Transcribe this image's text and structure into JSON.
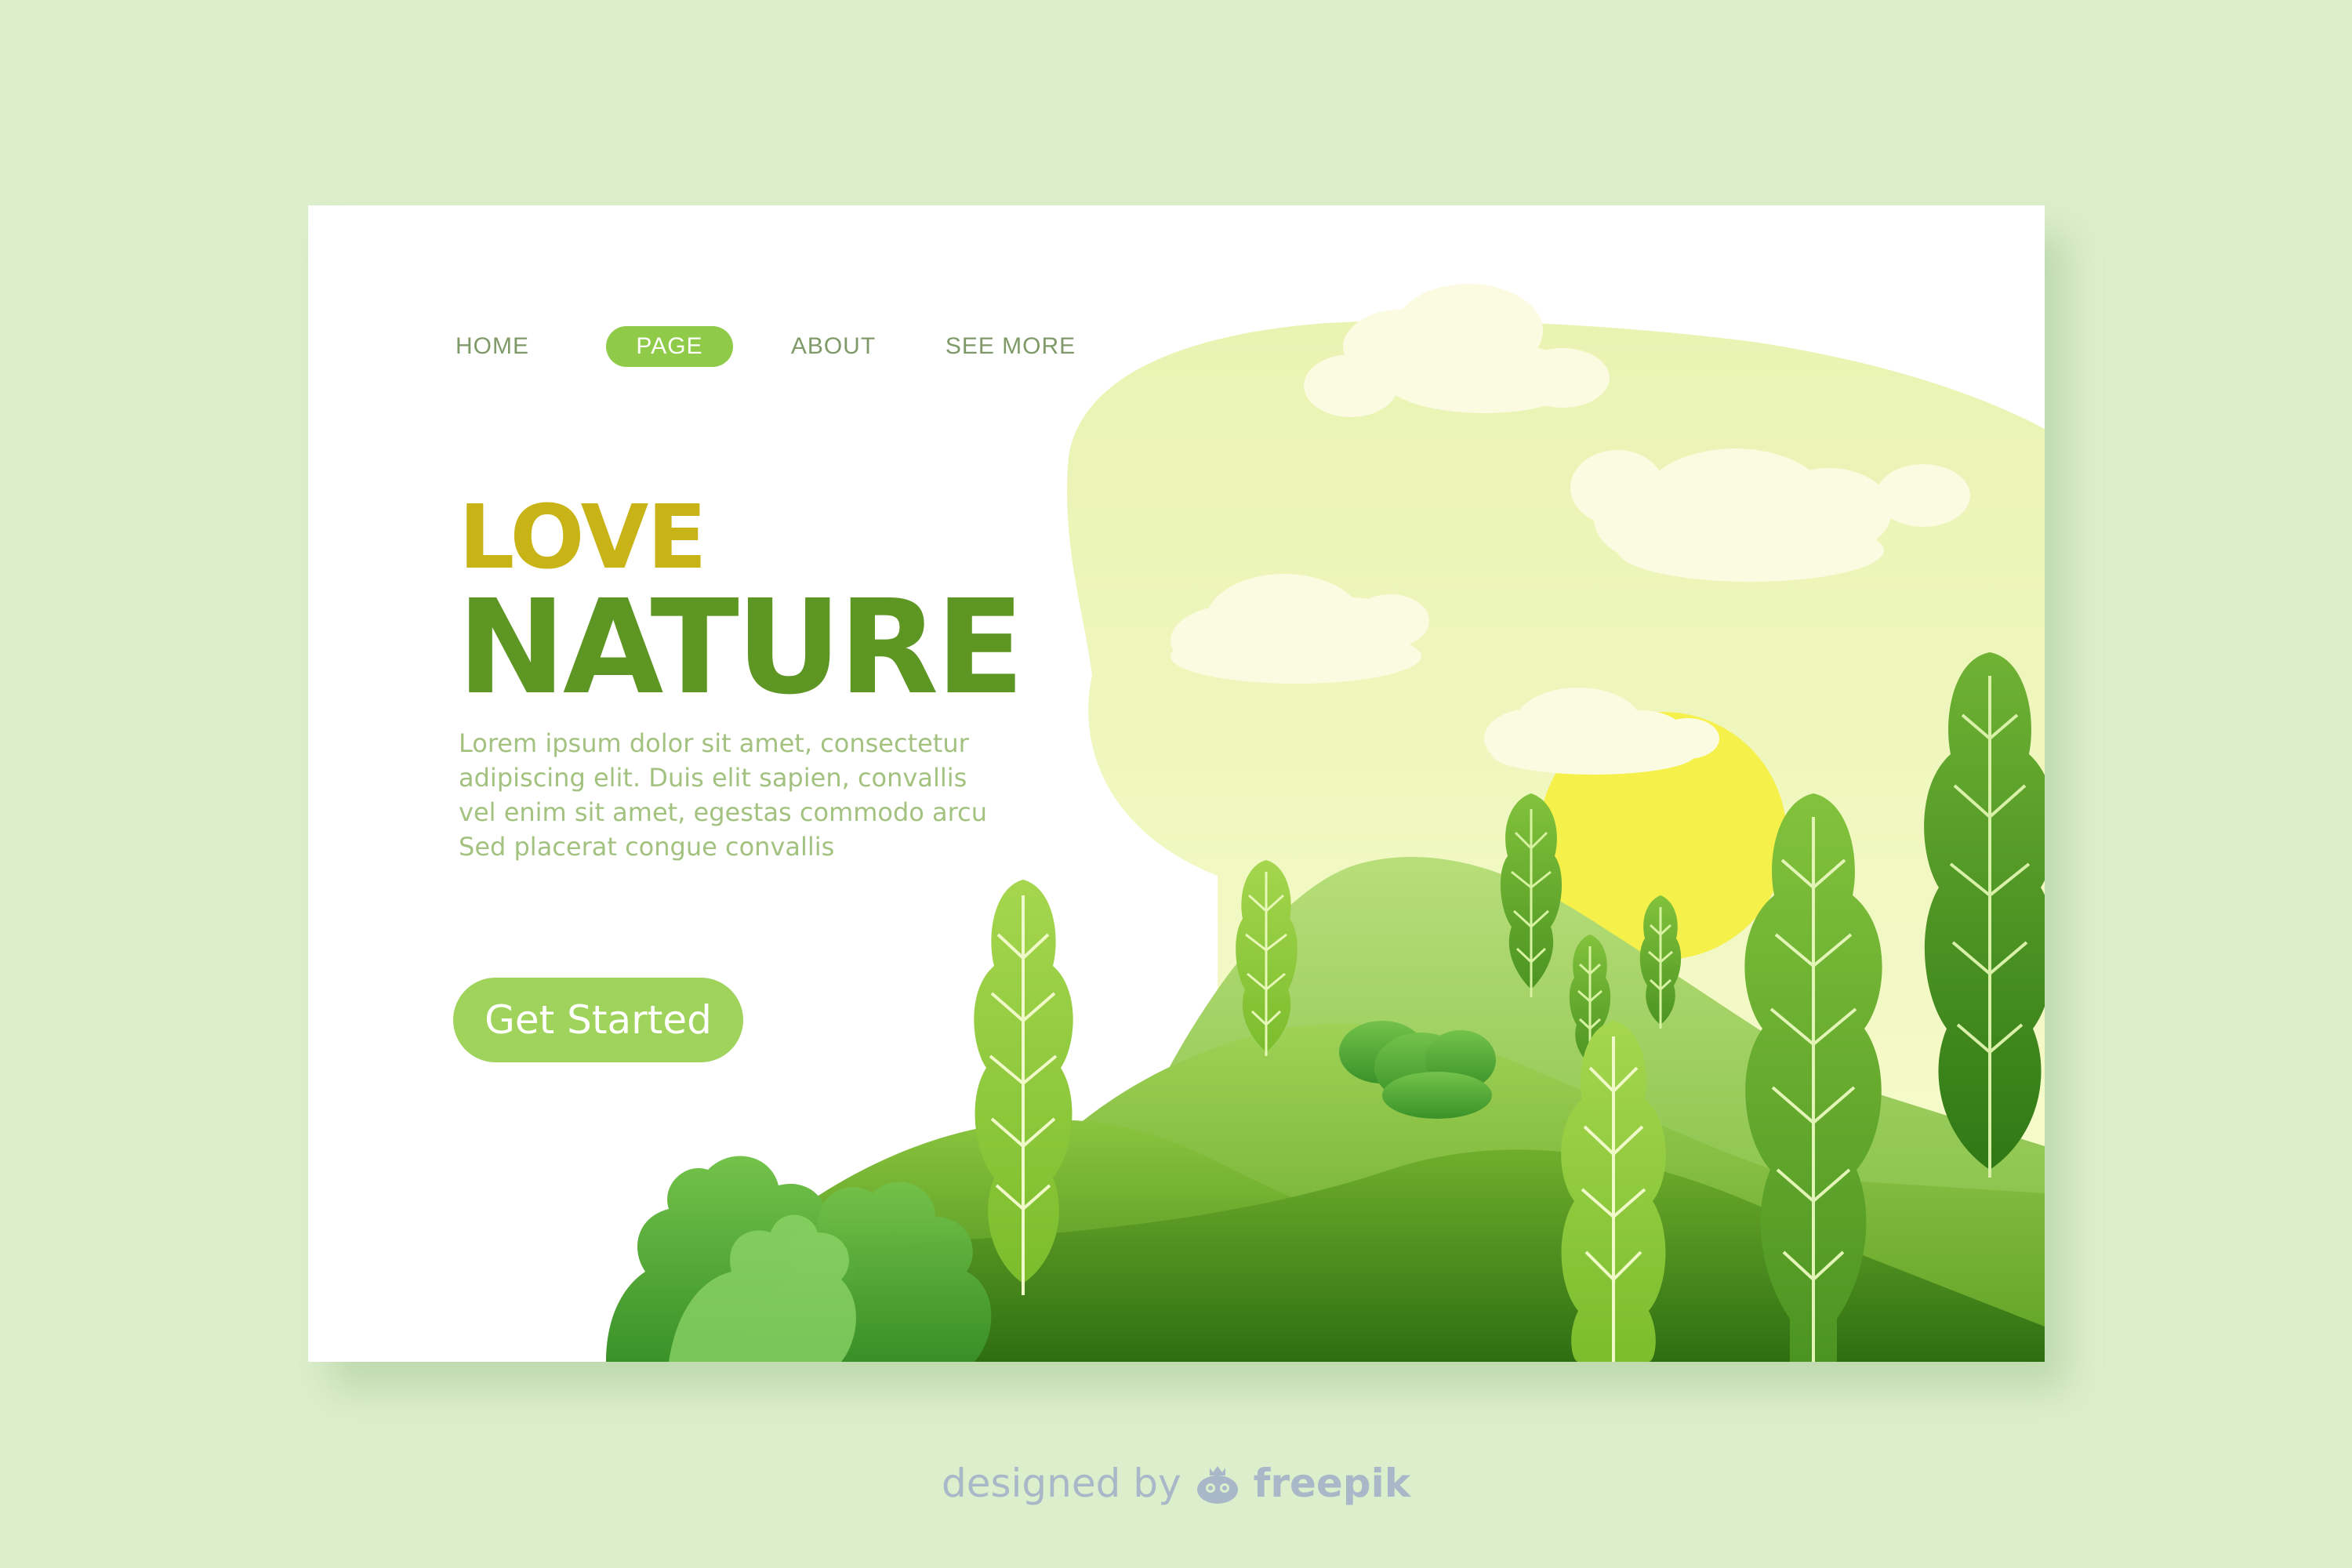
{
  "nav": {
    "items": [
      {
        "label": "HOME"
      },
      {
        "label": "PAGE"
      },
      {
        "label": "ABOUT"
      },
      {
        "label": "SEE MORE"
      }
    ]
  },
  "hero": {
    "title_line1": "LOVE",
    "title_line2": "NATURE",
    "body_lines": [
      "Lorem ipsum dolor sit amet, consectetur",
      "adipiscing elit. Duis  elit  sapien,  convallis",
      "vel  enim  sit amet,  egestas  commodo arcu",
      "Sed placerat congue convallis"
    ],
    "cta_label": "Get Started"
  },
  "footer": {
    "credit_prefix": "designed by",
    "credit_brand": "freepik",
    "logo_icon": "freepik-logo-icon"
  },
  "colors": {
    "background": "#dcefcc",
    "love": "#c9b417",
    "nature": "#5e9624",
    "accent": "#8fcb48",
    "nav_text": "#7f9a68",
    "body_text": "#a3c280"
  },
  "illustration": {
    "icons": [
      "cloud-icon",
      "sun-icon",
      "hill-icon",
      "tree-icon",
      "bush-icon"
    ]
  }
}
